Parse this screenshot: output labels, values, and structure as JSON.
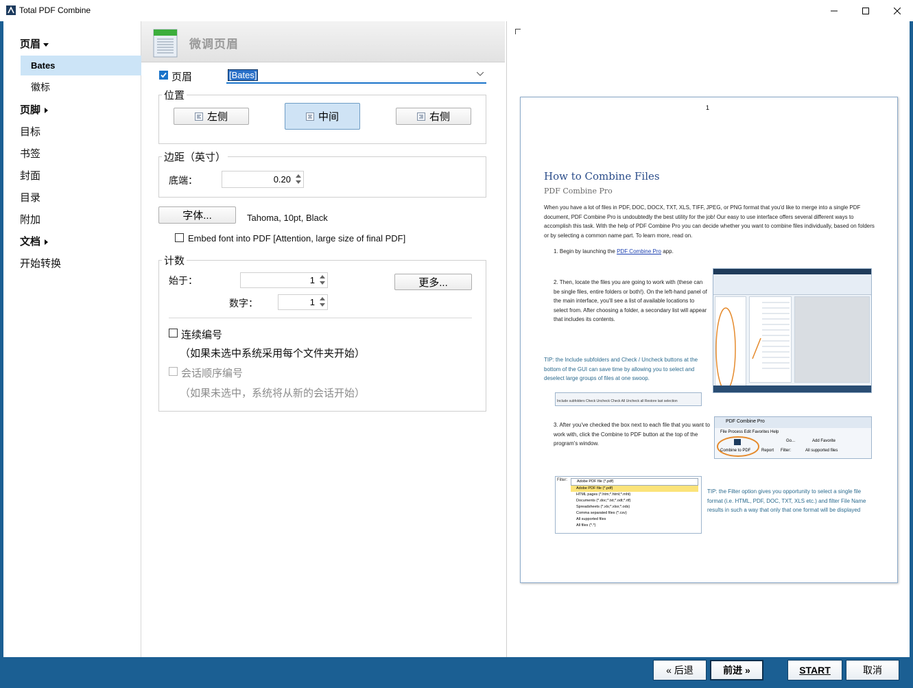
{
  "window": {
    "title": "Total PDF Combine",
    "controls": [
      "minimize",
      "maximize",
      "close"
    ]
  },
  "sidebar": {
    "items": [
      {
        "label": "页眉",
        "expander": "down",
        "bold": true
      },
      {
        "label": "Bates",
        "selected": true
      },
      {
        "label": "徽标"
      },
      {
        "label": "页脚",
        "expander": "right",
        "bold": true
      },
      {
        "label": "目标"
      },
      {
        "label": "书签"
      },
      {
        "label": "封面"
      },
      {
        "label": "目录"
      },
      {
        "label": "附加"
      },
      {
        "label": "文档",
        "expander": "right",
        "bold": true
      },
      {
        "label": "开始转换"
      }
    ]
  },
  "panel": {
    "title": "微调页眉",
    "header_checkbox_label": "页眉",
    "header_checked": true,
    "header_value": "[Bates]",
    "position": {
      "label": "位置",
      "left": "左侧",
      "center": "中间",
      "right": "右侧",
      "selected": "center"
    },
    "margin": {
      "label": "边距（英寸）",
      "bottom_label": "底端：",
      "bottom_value": "0.20"
    },
    "font": {
      "button": "字体...",
      "description": "Tahoma, 10pt, Black",
      "embed_label": "Embed font into PDF  [Attention, large size of final PDF]",
      "embed_checked": false
    },
    "counter": {
      "label": "计数",
      "start_label": "始于：",
      "start_value": "1",
      "more_button": "更多...",
      "digits_label": "数字：",
      "digits_value": "1",
      "continuous_label": "连续编号",
      "continuous_checked": false,
      "continuous_hint": "（如果未选中系统采用每个文件夹开始）",
      "session_label": "会话顺序编号",
      "session_checked": false,
      "session_hint": "（如果未选中，系统将从新的会话开始）"
    }
  },
  "preview": {
    "page_number": "1",
    "doc_title": "How to Combine Files",
    "doc_subtitle": "PDF Combine Pro",
    "intro": "When you have a lot of files in PDF, DOC, DOCX, TXT, XLS, TIFF, JPEG, or PNG format that you'd like to merge into a single PDF document, PDF Combine Pro is undoubtedly the best utility for the job! Our easy to use interface offers several different ways to accomplish this task. With the help of PDF Combine Pro you can decide whether you want to combine files individually, based on folders or by selecting a common name part. To learn more, read on.",
    "step1_prefix": "1.    Begin by launching the ",
    "step1_link": "PDF Combine Pro",
    "step1_suffix": " app.",
    "step2": "2.    Then, locate the files you are going to work with (these can be single files, entire folders or both!). On the left-hand panel of the main interface, you'll see a list of available locations to select from. After choosing a folder, a secondary list will appear that includes its contents.",
    "tip1": "TIP: the Include subfolders and Check / Uncheck buttons at the bottom of the GUI can save time by allowing you to select and deselect large groups of files at one swoop.",
    "step3": "3.    After you've checked the box next to each file that you want to work with, click the Combine to PDF button at the top of the program's window.",
    "tip2": "TIP: the Filter option gives you opportunity to select a single file format (i.e. HTML, PDF, DOC, TXT, XLS etc.) and filter File Name results in such a way that only that one format will be displayed",
    "thumb_toolbar": "Include subfolders   Check   Uncheck   Check All   Uncheck all   Restore last selection",
    "thumb_app_title": "PDF Combine Pro",
    "thumb_menu": "File   Process   Edit   Favorites   Help",
    "thumb_combine": "Combine to PDF",
    "thumb_report": "Report",
    "thumb_filter": "Filter:",
    "thumb_all": "All supported files",
    "thumb_go": "Go...",
    "thumb_add_fav": "Add Favorite",
    "filter_list": [
      "Adobe PDF file (*.pdf)",
      "Adobe PDF file (*.pdf)",
      "HTML pages (*.htm;*.html;*.mht)",
      "Documents (*.doc;*.txt;*.odt;*.rtf)",
      "Spreadsheets (*.xls;*.xlsx;*.ods)",
      "Comma separated files (*.csv)",
      "All supported files",
      "All files (*.*)"
    ]
  },
  "footer": {
    "back": "« 后退",
    "next": "前进 »",
    "start": "START",
    "cancel": "取消"
  },
  "colors": {
    "frame": "#1b5f93",
    "selection": "#cce4f7",
    "checkbox": "#1a73c9"
  }
}
